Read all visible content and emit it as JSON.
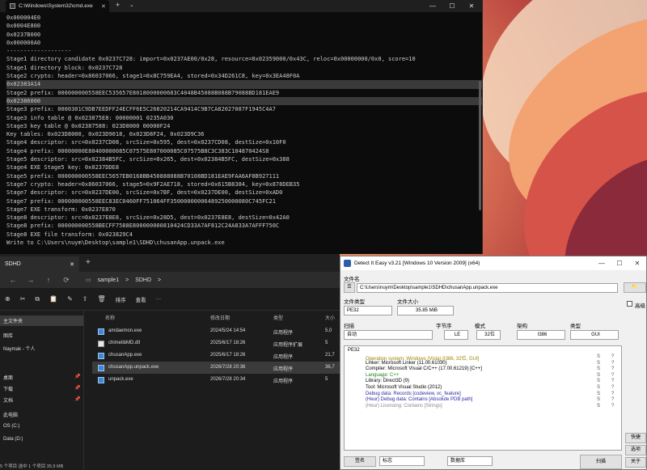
{
  "cmd": {
    "tab_title": "C:\\Windows\\System32\\cmd.exe",
    "tab_close": "✕",
    "new_tab": "+",
    "dropdown": "⌄",
    "minimize": "—",
    "maximize": "☐",
    "close": "✕",
    "lines": [
      "0x000004E0",
      "0x0004E800",
      "0x0237B000",
      "0x000000A0",
      "-------------------",
      "Stage1 directory candidate 0x0237C728: import=0x0237AE00/0x28, resource=0x02359000/0x43C, reloc=0x00000000/0x0, score=10",
      "Stage1 directory block: 0x0237C728",
      "Stage2 crypto: header=0x86037066, stage1=0x8C759EA4, stored=0x34D261C8, key=0x3EA48F0A",
      "0x02383A14",
      "Stage2 prefix: 000000000558EEC535657E8018000000683C4048B45088B088B79088BD181EAE9",
      "0x02386000",
      "Stage3 prefix: 0000301C9DB7EEDFF24ECFF6E5C26820214CA9414C9B7CA82027087F1945C4A7",
      "Stage3 info table @ 0x023875E8: 00000001 0235A030",
      "Stage3 key table @ 0x02387588: 023D8000 00000F24",
      "Key tables: 0x023D8000, 0x023D9018, 0x023D8F24, 0x023D9C36",
      "Stage4 descriptor: src=0x0237CD08, srcSize=0x595, dest=0x0237CD08, destSize=0x10F0",
      "Stage4 prefix: 00000000E80400000085C07575E807000085C07575B8C3C383C104870424S8",
      "Stage5 descriptor: src=0x02384B5FC, srcSize=0x265, dest=0x02384B5FC, destSize=0x388",
      "Stage4 EXE Stage5 key: 0x0237DDE8",
      "Stage5 prefix: 000000000558EEC5657EB0168BB450888088B70108BD181EAE9FAA6AF8B927111",
      "Stage7 crypto: header=0x86037066, stage5=0x9F2AE718, stored=0x615B8384, key=0x878DEB35",
      "Stage7 descriptor: src=0x0237DE00, srcSize=0x7BF, dest=0x0237DE00, destSize=0xAD0",
      "Stage7 prefix: 000000000558EEC83EC0460FF751064FF35000000006489250000080C745FC21",
      "Stage7 EXE transform: 0x0237E870",
      "Stage8 descriptor: src=0x0237E8E8, srcSize=0x28D5, dest=0x0237E8E8, destSize=0x42A0",
      "Stage8 prefix: 000000000558BECFF7588E800000000810424CD33A7AF812C24A833A7AFFF750C",
      "Stage8 EXE file transform: 0x023829C4",
      "Write to C:\\Users\\nuym\\Desktop\\sample1\\SDHD\\chusanApp.unpack.exe"
    ]
  },
  "explorer": {
    "tab_title": "SDHD",
    "tab_close": "✕",
    "new_tab": "+",
    "nav": {
      "back": "←",
      "forward": "→",
      "up": "↑",
      "refresh": "⟳"
    },
    "breadcrumbs": [
      "sample1",
      ">",
      "SDHD",
      ">"
    ],
    "toolbar": {
      "new": "⊕",
      "cut": "✂",
      "copy": "⧉",
      "paste": "📋",
      "rename": "✎",
      "share": "⇪",
      "delete": "🗑",
      "sort": "排序",
      "view": "查看",
      "more": "···"
    },
    "sidebar": [
      {
        "label": "主文件夹",
        "selected": true
      },
      {
        "label": "图库",
        "selected": false
      },
      {
        "label": "Naymak - 个人",
        "selected": false
      },
      {
        "label": "桌面",
        "selected": false,
        "pinned": true
      },
      {
        "label": "下载",
        "selected": false,
        "pinned": true
      },
      {
        "label": "文档",
        "selected": false,
        "pinned": true
      },
      {
        "label": "此电脑",
        "selected": false
      },
      {
        "label": "OS (C:)",
        "selected": false
      },
      {
        "label": "Data (D:)",
        "selected": false
      }
    ],
    "columns": {
      "name": "名称",
      "date": "修改日期",
      "type": "类型",
      "size": "大小"
    },
    "files": [
      {
        "name": "amdaemon.exe",
        "date": "2024/5/24 14:54",
        "type": "应用程序",
        "size": "5,0",
        "icon": "exe",
        "selected": false
      },
      {
        "name": "chimelibMD.dll",
        "date": "2025/6/17 18:26",
        "type": "应用程序扩展",
        "size": "5",
        "icon": "dll",
        "selected": false
      },
      {
        "name": "chusanApp.exe",
        "date": "2025/6/17 18:26",
        "type": "应用程序",
        "size": "21,7",
        "icon": "exe",
        "selected": false
      },
      {
        "name": "chusanApp.unpack.exe",
        "date": "2026/7/28 20:36",
        "type": "应用程序",
        "size": "36,7",
        "icon": "exe",
        "selected": true
      },
      {
        "name": "unpack.exe",
        "date": "2026/7/28 20:34",
        "type": "应用程序",
        "size": "5",
        "icon": "exe",
        "selected": false
      }
    ],
    "status": "5 个项目  选中 1 个项目  35.9 MB"
  },
  "die": {
    "title": "Detect It Easy v3.21 [Windows 10 Version 2009] (x64)",
    "minimize": "—",
    "maximize": "☐",
    "close": "✕",
    "file_name_label": "文件名",
    "file_path": "C:\\Users\\nuym\\Desktop\\sample1\\SDHD\\chusanApp.unpack.exe",
    "file_type_label": "文件类型",
    "file_size_label": "文件大小",
    "file_type": "PE32",
    "file_size": "35.85 MiB",
    "advanced_label": "高级",
    "scan_label": "扫描",
    "endian_label": "字节序",
    "mode_label": "模式",
    "arch_label": "架构",
    "type_label": "类型",
    "scan_value": "自动",
    "endian": "LE",
    "mode": "32位",
    "arch": "I386",
    "type": "GUI",
    "tree_root": "PE32",
    "detections": [
      {
        "text": "Operation system: Windows (Vista) [I386, 32位, GUI]",
        "color": "#9a8600",
        "s": "S",
        "q": "?"
      },
      {
        "text": "Linker: Microsoft Linker (11.00.61030)",
        "color": "#000000",
        "s": "S",
        "q": "?"
      },
      {
        "text": "Compiler: Microsoft Visual C/C++ (17.00.61219) [C++]",
        "color": "#000000",
        "s": "S",
        "q": "?"
      },
      {
        "text": "Language: C++",
        "color": "#1a8a1a",
        "s": "S",
        "q": "?"
      },
      {
        "text": "Library: Direct3D (9)",
        "color": "#000000",
        "s": "S",
        "q": "?"
      },
      {
        "text": "Tool: Microsoft Visual Studio (2012)",
        "color": "#000000",
        "s": "S",
        "q": "?"
      },
      {
        "text": "Debug data: Records [codeview, vc_feature]",
        "color": "#2a2aa0",
        "s": "S",
        "q": "?"
      },
      {
        "text": "(Heur) Debug data: Contains [Absolute PDB path]",
        "color": "#2a2aa0",
        "s": "S",
        "q": "?"
      },
      {
        "text": "(Heur) Licensing: Contains [Strings]",
        "color": "#888888",
        "s": "S",
        "q": "?"
      }
    ],
    "side_buttons": [
      "快捷",
      "选项",
      "关于"
    ],
    "bottom": {
      "signature": "签名",
      "recursive": "标志",
      "database": "数据库",
      "scan_button": "扫描"
    }
  }
}
